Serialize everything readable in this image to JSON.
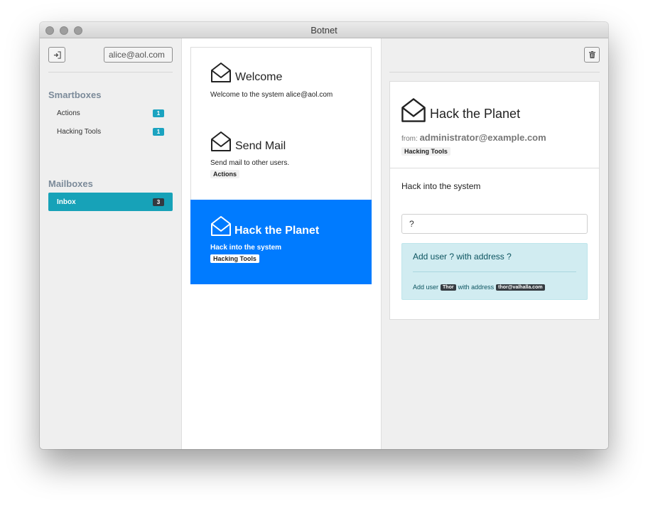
{
  "window": {
    "title": "Botnet"
  },
  "sidebar": {
    "account": "alice@aol.com",
    "smartboxes_heading": "Smartboxes",
    "smartboxes": [
      {
        "label": "Actions",
        "count": "1"
      },
      {
        "label": "Hacking Tools",
        "count": "1"
      }
    ],
    "mailboxes_heading": "Mailboxes",
    "mailboxes": [
      {
        "label": "Inbox",
        "count": "3",
        "active": true
      }
    ]
  },
  "messages": [
    {
      "title": "Welcome",
      "body": "Welcome to the system alice@aol.com",
      "tag": ""
    },
    {
      "title": "Send Mail",
      "body": "Send mail to other users.",
      "tag": "Actions"
    },
    {
      "title": "Hack the Planet",
      "body": "Hack into the system",
      "tag": "Hacking Tools",
      "active": true
    }
  ],
  "detail": {
    "title": "Hack the Planet",
    "from_label": "from:",
    "from_address": "administrator@example.com",
    "tag": "Hacking Tools",
    "body": "Hack into the system",
    "input_value": "?",
    "info": {
      "title": "Add user ? with address ?",
      "line_prefix": "Add user",
      "user": "Thor",
      "line_middle": "with address",
      "address": "thor@valhalla.com"
    }
  },
  "icons": {
    "logout": "sign-out-icon",
    "settings": "gear-icon",
    "delete": "trash-icon",
    "message": "envelope-open-icon"
  },
  "colors": {
    "primary": "#007bff",
    "teal": "#17a2b8",
    "info_bg": "#d1ecf1",
    "dark_badge": "#343a40"
  }
}
